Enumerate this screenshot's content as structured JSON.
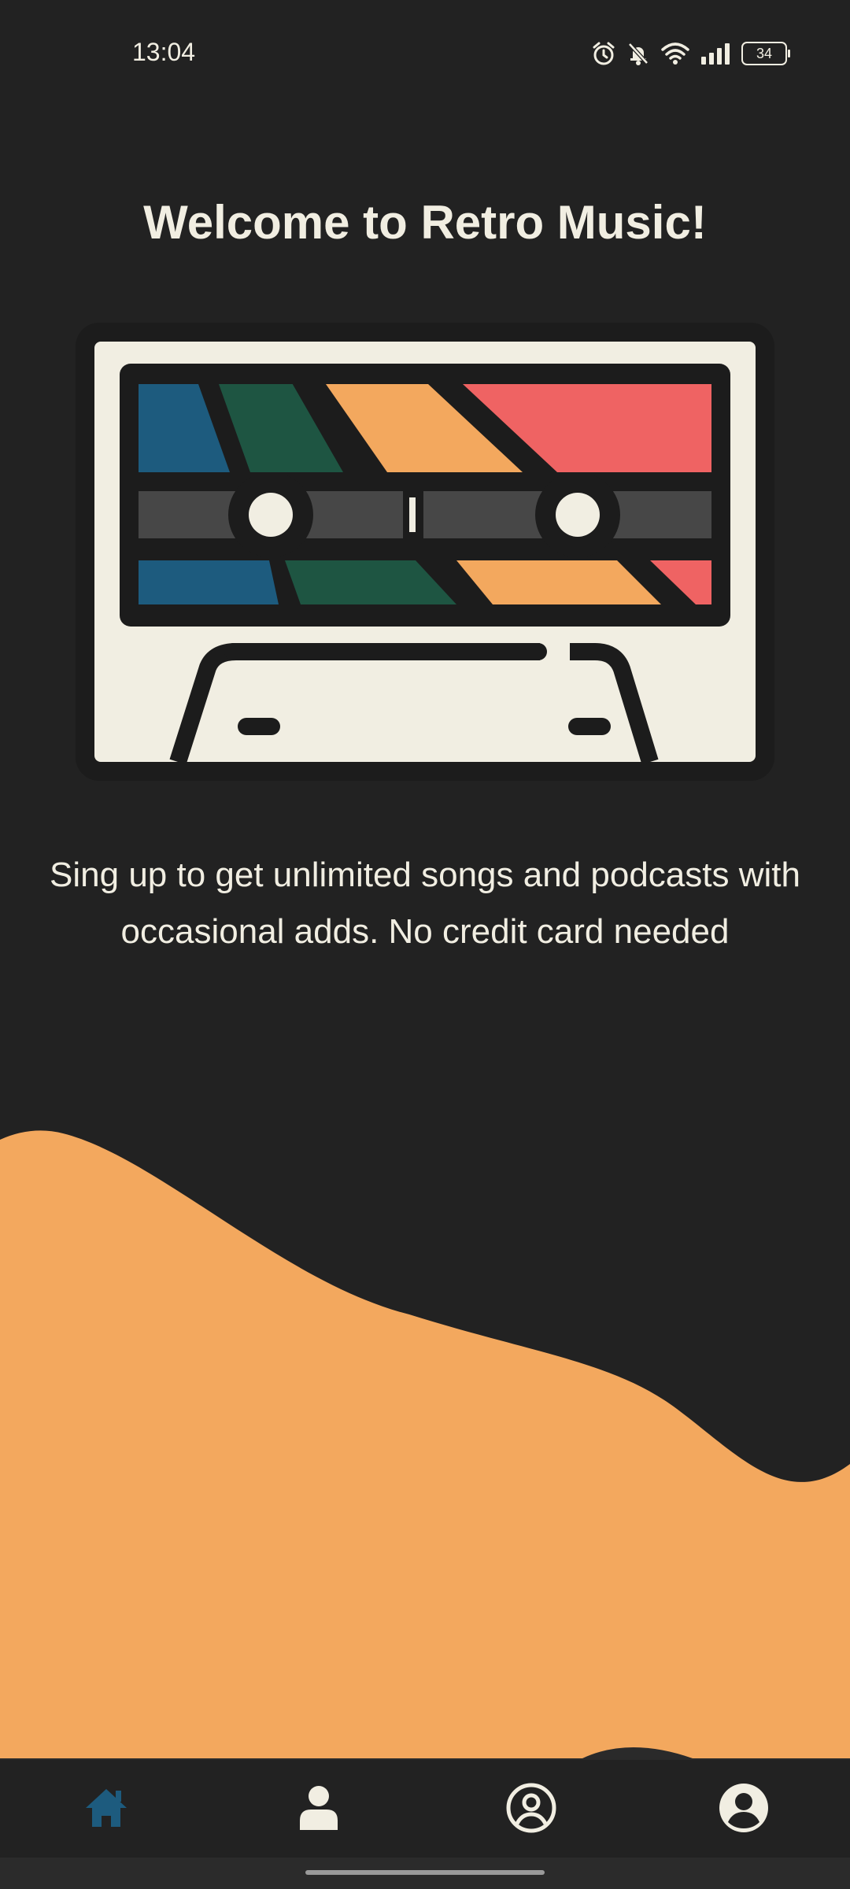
{
  "status_bar": {
    "time": "13:04",
    "battery_level": "34",
    "icons": [
      "alarm-icon",
      "bell-muted-icon",
      "wifi-icon",
      "signal-icon",
      "battery-icon"
    ]
  },
  "main": {
    "title": "Welcome to Retro Music!",
    "illustration": "cassette-tape",
    "tagline": "Sing up to get unlimited songs and podcasts with occasional adds. No credit card needed"
  },
  "bottom_nav": {
    "items": [
      {
        "icon": "home-icon",
        "active": true
      },
      {
        "icon": "person-icon",
        "active": false
      },
      {
        "icon": "account-circle-outline-icon",
        "active": false
      },
      {
        "icon": "account-circle-icon",
        "active": false
      }
    ]
  },
  "colors": {
    "background": "#222222",
    "cream": "#f1eee2",
    "orange": "#f3a85e",
    "blue": "#1d5b7e",
    "green": "#1e5542",
    "red": "#ef6363",
    "active_nav": "#1d5b7e"
  }
}
